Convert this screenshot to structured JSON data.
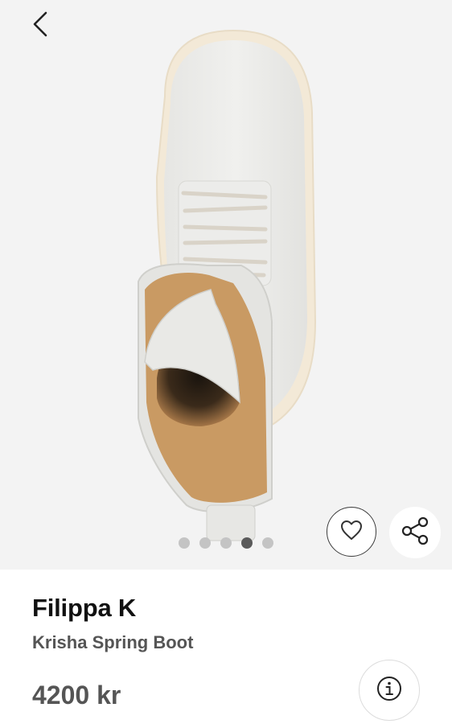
{
  "header": {
    "back_icon": "chevron-left-icon"
  },
  "gallery": {
    "image_description": "White leather lace-up boot viewed from above",
    "dot_count": 5,
    "active_dot_index": 3
  },
  "actions": {
    "favorite_icon": "heart-outline-icon",
    "share_icon": "share-icon",
    "info_icon": "info-icon"
  },
  "product": {
    "brand": "Filippa K",
    "name": "Krisha Spring Boot",
    "price": "4200 kr"
  }
}
